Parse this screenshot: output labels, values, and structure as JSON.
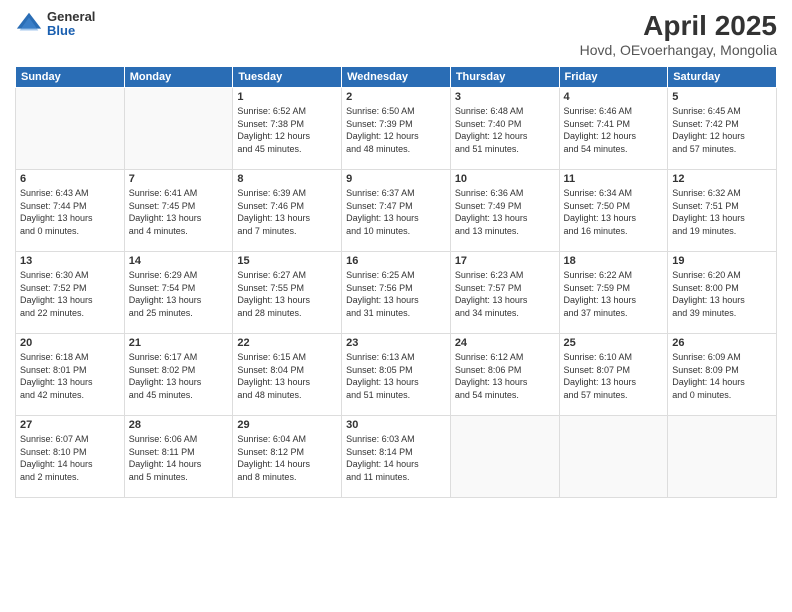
{
  "header": {
    "logo_general": "General",
    "logo_blue": "Blue",
    "title": "April 2025",
    "subtitle": "Hovd, OEvoerhangay, Mongolia"
  },
  "weekdays": [
    "Sunday",
    "Monday",
    "Tuesday",
    "Wednesday",
    "Thursday",
    "Friday",
    "Saturday"
  ],
  "weeks": [
    [
      {
        "day": "",
        "info": ""
      },
      {
        "day": "",
        "info": ""
      },
      {
        "day": "1",
        "info": "Sunrise: 6:52 AM\nSunset: 7:38 PM\nDaylight: 12 hours\nand 45 minutes."
      },
      {
        "day": "2",
        "info": "Sunrise: 6:50 AM\nSunset: 7:39 PM\nDaylight: 12 hours\nand 48 minutes."
      },
      {
        "day": "3",
        "info": "Sunrise: 6:48 AM\nSunset: 7:40 PM\nDaylight: 12 hours\nand 51 minutes."
      },
      {
        "day": "4",
        "info": "Sunrise: 6:46 AM\nSunset: 7:41 PM\nDaylight: 12 hours\nand 54 minutes."
      },
      {
        "day": "5",
        "info": "Sunrise: 6:45 AM\nSunset: 7:42 PM\nDaylight: 12 hours\nand 57 minutes."
      }
    ],
    [
      {
        "day": "6",
        "info": "Sunrise: 6:43 AM\nSunset: 7:44 PM\nDaylight: 13 hours\nand 0 minutes."
      },
      {
        "day": "7",
        "info": "Sunrise: 6:41 AM\nSunset: 7:45 PM\nDaylight: 13 hours\nand 4 minutes."
      },
      {
        "day": "8",
        "info": "Sunrise: 6:39 AM\nSunset: 7:46 PM\nDaylight: 13 hours\nand 7 minutes."
      },
      {
        "day": "9",
        "info": "Sunrise: 6:37 AM\nSunset: 7:47 PM\nDaylight: 13 hours\nand 10 minutes."
      },
      {
        "day": "10",
        "info": "Sunrise: 6:36 AM\nSunset: 7:49 PM\nDaylight: 13 hours\nand 13 minutes."
      },
      {
        "day": "11",
        "info": "Sunrise: 6:34 AM\nSunset: 7:50 PM\nDaylight: 13 hours\nand 16 minutes."
      },
      {
        "day": "12",
        "info": "Sunrise: 6:32 AM\nSunset: 7:51 PM\nDaylight: 13 hours\nand 19 minutes."
      }
    ],
    [
      {
        "day": "13",
        "info": "Sunrise: 6:30 AM\nSunset: 7:52 PM\nDaylight: 13 hours\nand 22 minutes."
      },
      {
        "day": "14",
        "info": "Sunrise: 6:29 AM\nSunset: 7:54 PM\nDaylight: 13 hours\nand 25 minutes."
      },
      {
        "day": "15",
        "info": "Sunrise: 6:27 AM\nSunset: 7:55 PM\nDaylight: 13 hours\nand 28 minutes."
      },
      {
        "day": "16",
        "info": "Sunrise: 6:25 AM\nSunset: 7:56 PM\nDaylight: 13 hours\nand 31 minutes."
      },
      {
        "day": "17",
        "info": "Sunrise: 6:23 AM\nSunset: 7:57 PM\nDaylight: 13 hours\nand 34 minutes."
      },
      {
        "day": "18",
        "info": "Sunrise: 6:22 AM\nSunset: 7:59 PM\nDaylight: 13 hours\nand 37 minutes."
      },
      {
        "day": "19",
        "info": "Sunrise: 6:20 AM\nSunset: 8:00 PM\nDaylight: 13 hours\nand 39 minutes."
      }
    ],
    [
      {
        "day": "20",
        "info": "Sunrise: 6:18 AM\nSunset: 8:01 PM\nDaylight: 13 hours\nand 42 minutes."
      },
      {
        "day": "21",
        "info": "Sunrise: 6:17 AM\nSunset: 8:02 PM\nDaylight: 13 hours\nand 45 minutes."
      },
      {
        "day": "22",
        "info": "Sunrise: 6:15 AM\nSunset: 8:04 PM\nDaylight: 13 hours\nand 48 minutes."
      },
      {
        "day": "23",
        "info": "Sunrise: 6:13 AM\nSunset: 8:05 PM\nDaylight: 13 hours\nand 51 minutes."
      },
      {
        "day": "24",
        "info": "Sunrise: 6:12 AM\nSunset: 8:06 PM\nDaylight: 13 hours\nand 54 minutes."
      },
      {
        "day": "25",
        "info": "Sunrise: 6:10 AM\nSunset: 8:07 PM\nDaylight: 13 hours\nand 57 minutes."
      },
      {
        "day": "26",
        "info": "Sunrise: 6:09 AM\nSunset: 8:09 PM\nDaylight: 14 hours\nand 0 minutes."
      }
    ],
    [
      {
        "day": "27",
        "info": "Sunrise: 6:07 AM\nSunset: 8:10 PM\nDaylight: 14 hours\nand 2 minutes."
      },
      {
        "day": "28",
        "info": "Sunrise: 6:06 AM\nSunset: 8:11 PM\nDaylight: 14 hours\nand 5 minutes."
      },
      {
        "day": "29",
        "info": "Sunrise: 6:04 AM\nSunset: 8:12 PM\nDaylight: 14 hours\nand 8 minutes."
      },
      {
        "day": "30",
        "info": "Sunrise: 6:03 AM\nSunset: 8:14 PM\nDaylight: 14 hours\nand 11 minutes."
      },
      {
        "day": "",
        "info": ""
      },
      {
        "day": "",
        "info": ""
      },
      {
        "day": "",
        "info": ""
      }
    ]
  ]
}
